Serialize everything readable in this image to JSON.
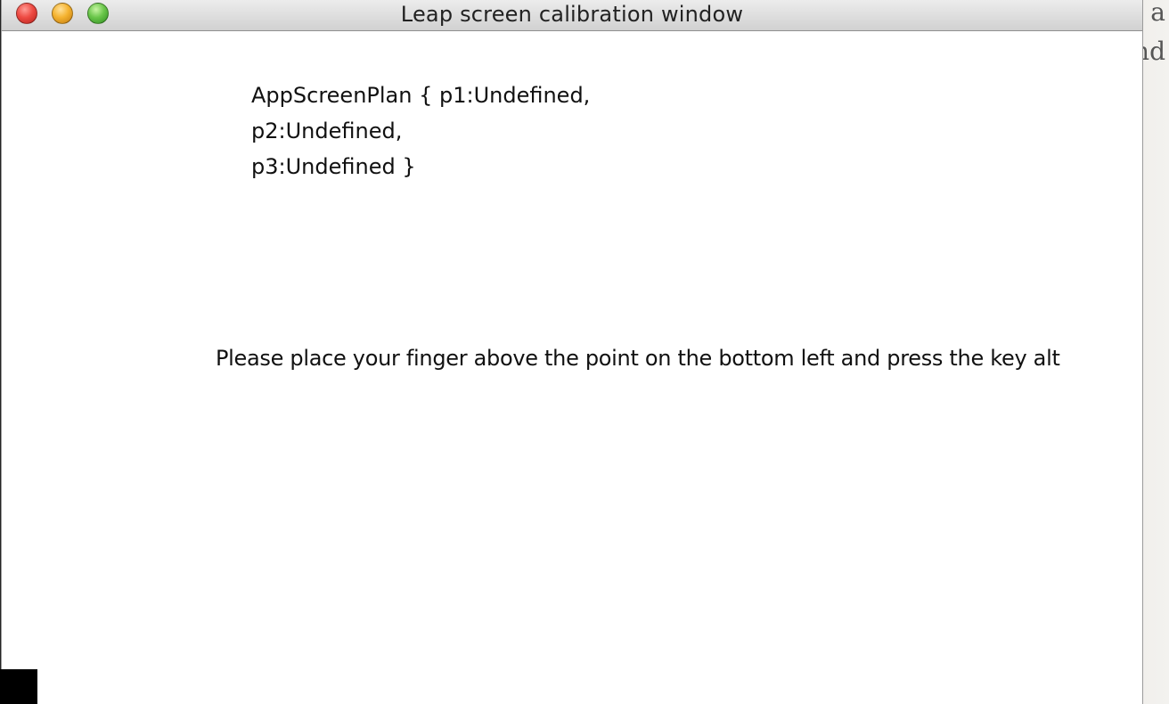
{
  "window": {
    "title": "Leap screen calibration window"
  },
  "background_app": {
    "text_fragments": [
      "a",
      "nd"
    ]
  },
  "calibration": {
    "plan_lines": [
      "AppScreenPlan { p1:Undefined,",
      "p2:Undefined,",
      "p3:Undefined }"
    ],
    "instruction": "Please place your finger above the point on the bottom left and press the key alt"
  },
  "colors": {
    "close_button": "#ee4b43",
    "minimize_button": "#f5b330",
    "zoom_button": "#6ac64a",
    "target_point": "#000000"
  }
}
